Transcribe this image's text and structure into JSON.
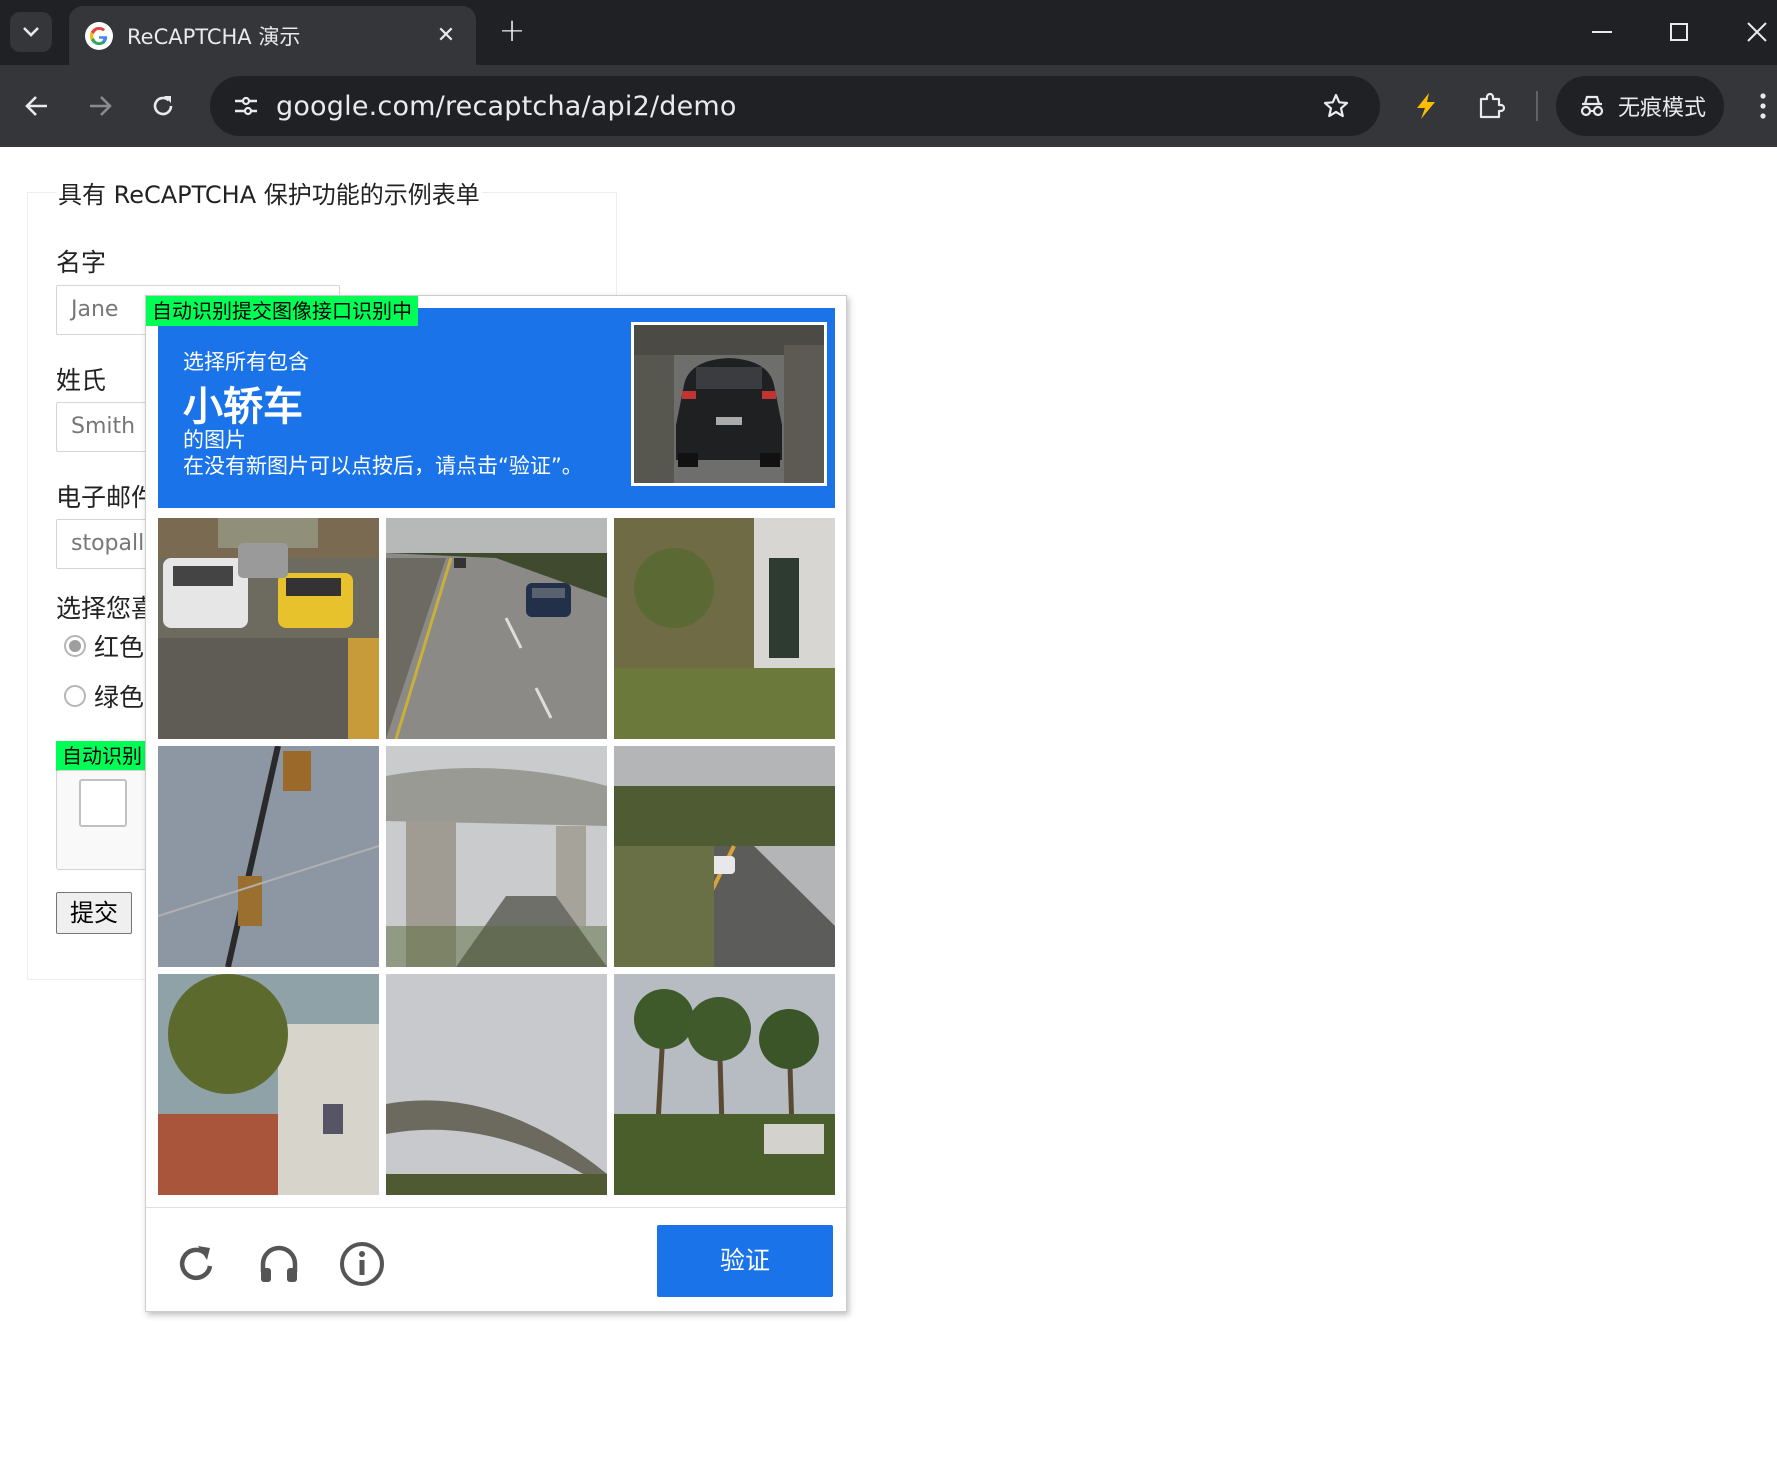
{
  "browser": {
    "tab_title": "ReCAPTCHA 演示",
    "url": "google.com/recaptcha/api2/demo",
    "incognito_label": "无痕模式",
    "icons": [
      "tab-search-icon",
      "google-favicon",
      "close-icon",
      "plus-icon",
      "minimize-icon",
      "maximize-icon",
      "window-close-icon",
      "back-arrow-icon",
      "forward-arrow-icon",
      "reload-icon",
      "site-info-icon",
      "star-icon",
      "lightning-extension-icon",
      "puzzle-extension-icon",
      "incognito-icon",
      "kebab-menu-icon"
    ],
    "accent_color": "#fbbc04"
  },
  "form": {
    "legend": "具有 ReCAPTCHA 保护功能的示例表单",
    "first_name_label": "名字",
    "first_name_value": "Jane",
    "last_name_label": "姓氏",
    "last_name_value": "Smith",
    "email_label": "电子邮件",
    "email_value": "stopallbots@gmail.com",
    "color_question": "选择您喜欢的颜色",
    "radio_red": "红色",
    "radio_green": "绿色",
    "badge_anchor": "自动识别",
    "submit_label": "提交"
  },
  "captcha": {
    "badge": "自动识别提交图像接口识别中",
    "instruction_line1": "选择所有包含",
    "target_object": "小轿车",
    "instruction_line2": "的图片",
    "instruction_line3": "在没有新图片可以点按后，请点击“验证”。",
    "verify_label": "验证",
    "header_color": "#1a73e8",
    "footer_icons": [
      "reload-icon",
      "headphones-icon",
      "info-icon"
    ],
    "tiles": [
      "busy street with parked cars and yellow taxi",
      "highway with dark SUV",
      "building wall with plants",
      "traffic light against sky",
      "highway overpass",
      "rural road with white car",
      "trees and building",
      "curved overpass",
      "palm trees and house"
    ]
  }
}
